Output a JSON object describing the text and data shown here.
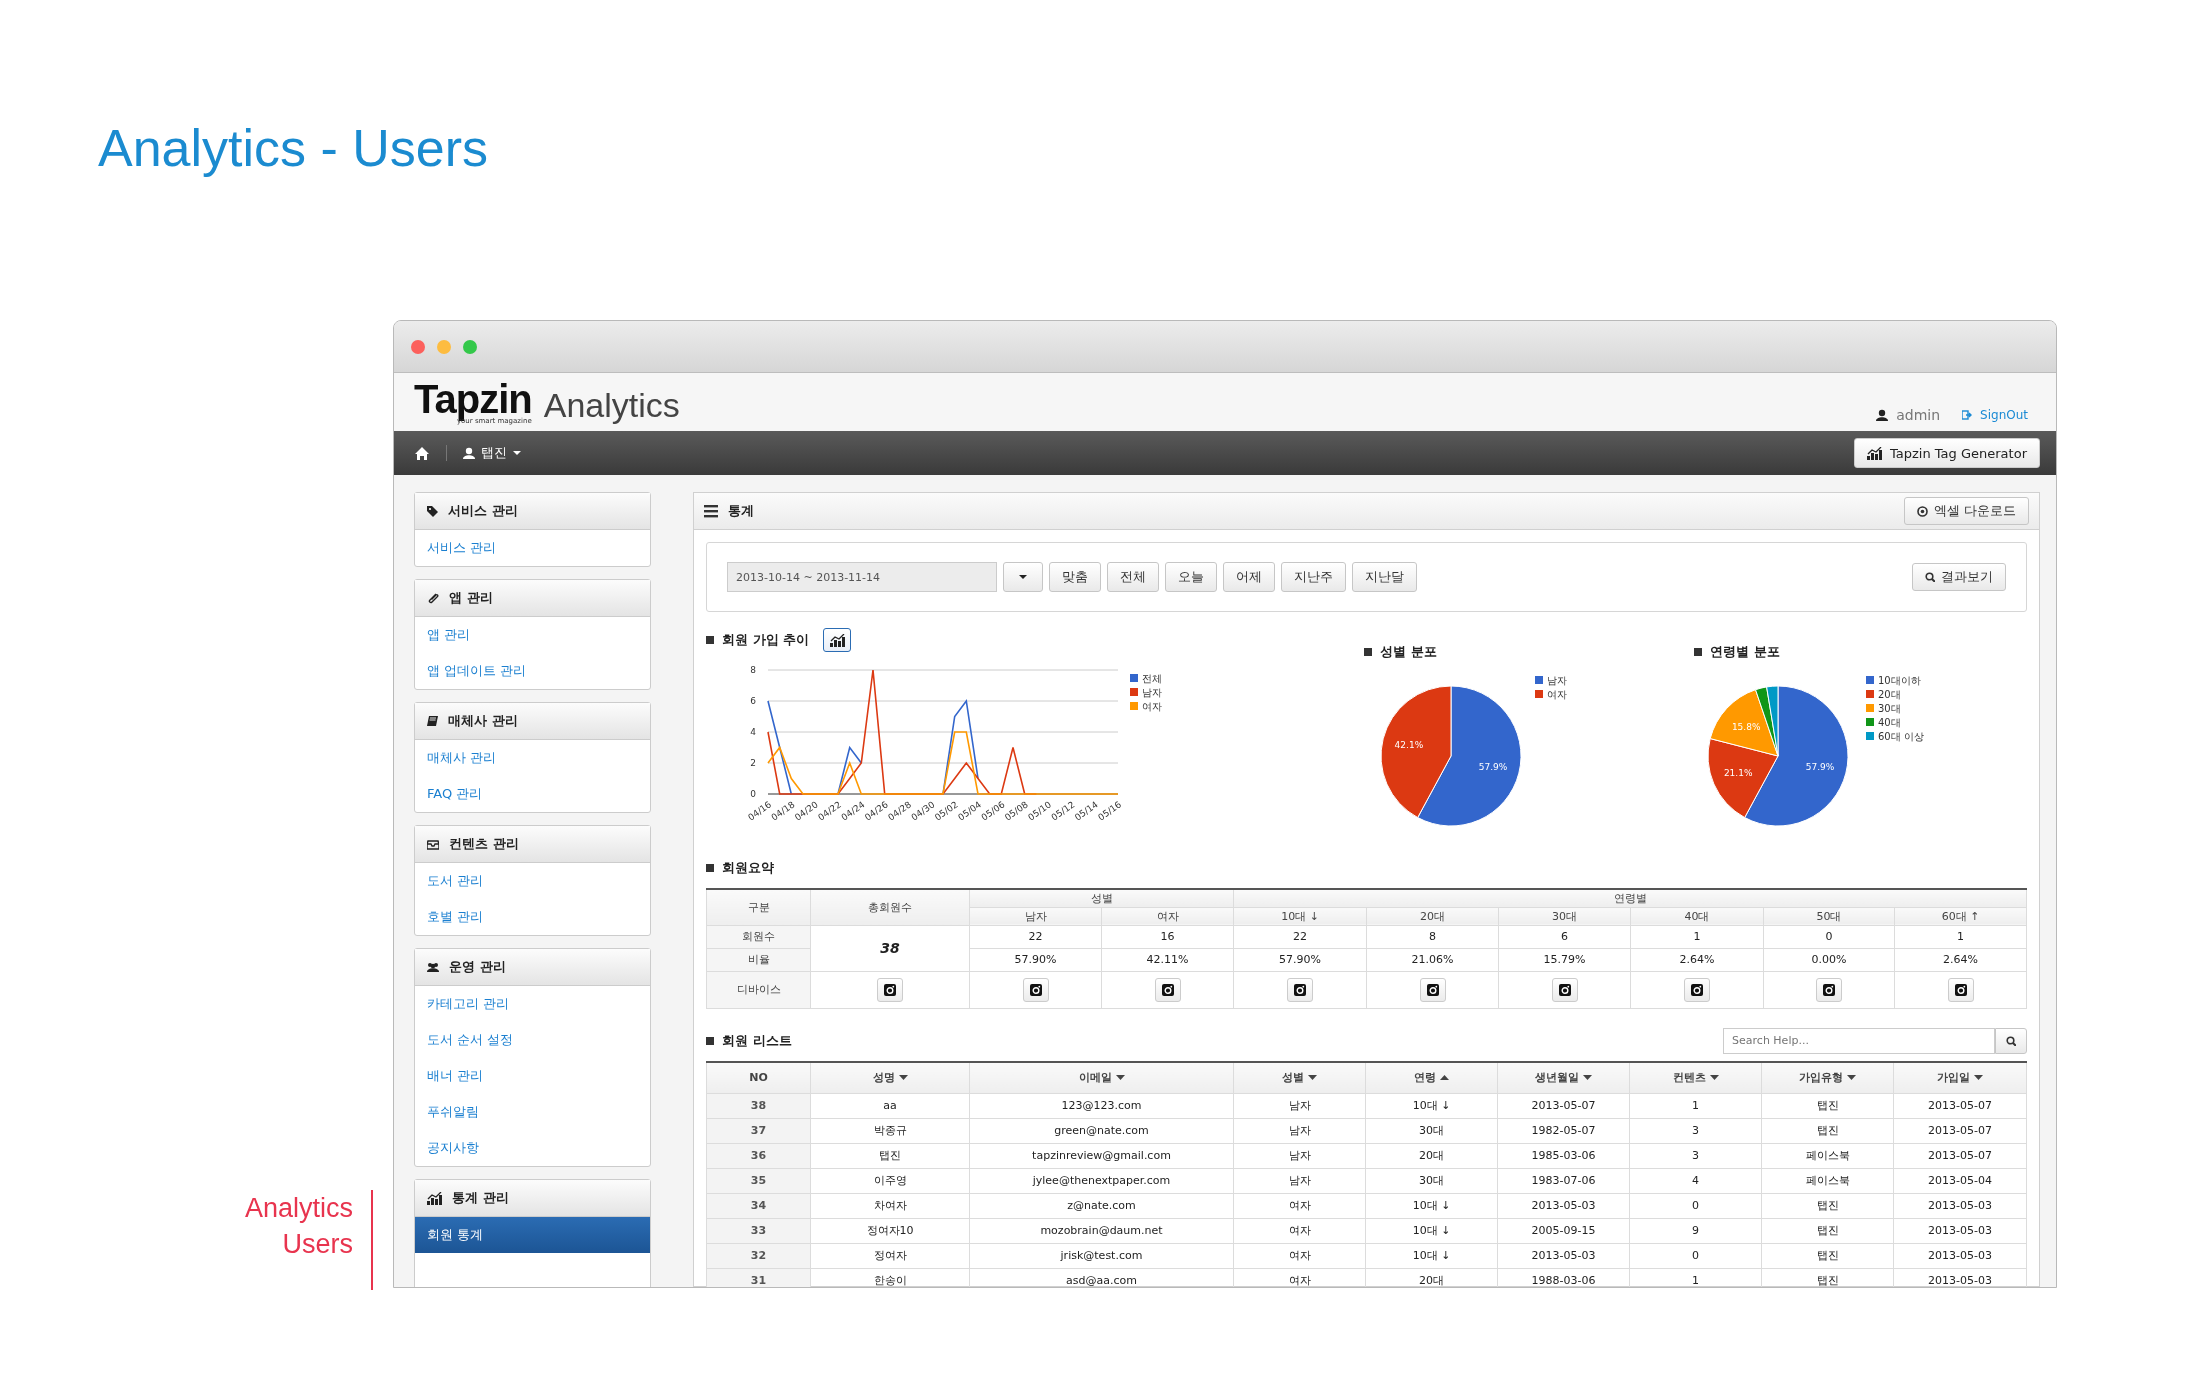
{
  "page_title": "Analytics - Users",
  "caption": [
    "Analytics",
    "Users"
  ],
  "window": {
    "logo": {
      "brand": "Tapzin",
      "tagline": "your smart magazine",
      "product": "Analytics"
    },
    "user": {
      "name": "admin",
      "signout": "SignOut"
    },
    "navbar": {
      "menu": "탭진",
      "button": "Tapzin Tag Generator"
    },
    "sidebar": [
      {
        "title": "서비스 관리",
        "items": [
          {
            "label": "서비스 관리",
            "selected": false
          }
        ]
      },
      {
        "title": "앱 관리",
        "items": [
          {
            "label": "앱 관리",
            "selected": false
          },
          {
            "label": "앱 업데이트 관리",
            "selected": false
          }
        ]
      },
      {
        "title": "매체사 관리",
        "items": [
          {
            "label": "매체사 관리",
            "selected": false
          },
          {
            "label": "FAQ 관리",
            "selected": false
          }
        ]
      },
      {
        "title": "컨텐츠 관리",
        "items": [
          {
            "label": "도서 관리",
            "selected": false
          },
          {
            "label": "호별 관리",
            "selected": false
          }
        ]
      },
      {
        "title": "운영 관리",
        "items": [
          {
            "label": "카테고리 관리",
            "selected": false
          },
          {
            "label": "도서 순서 설정",
            "selected": false
          },
          {
            "label": "배너 관리",
            "selected": false
          },
          {
            "label": "푸쉬알림",
            "selected": false
          },
          {
            "label": "공지사항",
            "selected": false
          }
        ]
      },
      {
        "title": "통계 관리",
        "items": [
          {
            "label": "회원 통계",
            "selected": true
          }
        ]
      }
    ],
    "panel": {
      "title": "통계",
      "download": "엑셀 다운로드"
    },
    "filter": {
      "date_range": "2013-10-14 ~ 2013-11-14",
      "presets": [
        "맞춤",
        "전체",
        "오늘",
        "어제",
        "지난주",
        "지난달"
      ],
      "submit": "결과보기"
    },
    "signup_trend": {
      "title": "회원 가입 추이",
      "chart_data": {
        "type": "line",
        "categories": [
          "04/16",
          null,
          "04/18",
          null,
          "04/20",
          null,
          "04/22",
          null,
          "04/24",
          null,
          "04/26",
          null,
          "04/28",
          null,
          "04/30",
          null,
          "05/02",
          null,
          "05/04",
          null,
          "05/06",
          null,
          "05/08",
          null,
          "05/10",
          null,
          "05/12",
          null,
          "05/14",
          null,
          "05/16"
        ],
        "ylim": [
          0,
          8
        ],
        "yticks": [
          0,
          2,
          4,
          6,
          8
        ],
        "grid": true,
        "legend": "right",
        "series": [
          {
            "name": "전체",
            "color": "#3366cc",
            "values": [
              6,
              3,
              0,
              null,
              null,
              null,
              0,
              3,
              2,
              null,
              null,
              null,
              null,
              null,
              null,
              0,
              5,
              6,
              1,
              null,
              null,
              null,
              null,
              null,
              null,
              null,
              null,
              null,
              null,
              null,
              null
            ]
          },
          {
            "name": "남자",
            "color": "#dc3912",
            "values": [
              4,
              0,
              0,
              0,
              0,
              0,
              0,
              1,
              2,
              8,
              0,
              0,
              0,
              0,
              0,
              0,
              1,
              2,
              1,
              0,
              0,
              3,
              0,
              0,
              null,
              null,
              null,
              null,
              null,
              null,
              null
            ]
          },
          {
            "name": "여자",
            "color": "#ff9900",
            "values": [
              2,
              3,
              1,
              0,
              0,
              0,
              0,
              2,
              0,
              0,
              0,
              0,
              0,
              0,
              0,
              0,
              4,
              4,
              0,
              0,
              0,
              0,
              0,
              0,
              0,
              0,
              0,
              0,
              0,
              0,
              0
            ]
          }
        ]
      }
    },
    "gender": {
      "title": "성별 분포",
      "chart_data": {
        "type": "pie",
        "legend": "right",
        "categories": [
          "남자",
          "여자"
        ],
        "colors": [
          "#3366cc",
          "#dc3912"
        ],
        "values": [
          57.9,
          42.1
        ],
        "value_labels": [
          "57.9%",
          "42.1%"
        ]
      }
    },
    "age": {
      "title": "연령별 분포",
      "chart_data": {
        "type": "pie",
        "legend": "right",
        "categories": [
          "10대이하",
          "20대",
          "30대",
          "40대",
          "60대 이상"
        ],
        "colors": [
          "#3366cc",
          "#dc3912",
          "#ff9900",
          "#109618",
          "#0099c6"
        ],
        "values": [
          57.9,
          21.1,
          15.8,
          2.6,
          2.6
        ],
        "value_labels": [
          "57.9%",
          "21.1%",
          "15.8%",
          null,
          null
        ]
      }
    },
    "summary": {
      "title": "회원요약",
      "corner": "구분",
      "total_header": "총회원수",
      "groups": [
        {
          "label": "성별",
          "columns": [
            "남자",
            "여자"
          ]
        },
        {
          "label": "연령별",
          "columns": [
            "10대 ↓",
            "20대",
            "30대",
            "40대",
            "50대",
            "60대 ↑"
          ]
        }
      ],
      "total": "38",
      "rows": [
        {
          "label": "회원수",
          "kind": "values",
          "values": [
            "22",
            "16",
            "22",
            "8",
            "6",
            "1",
            "0",
            "1"
          ]
        },
        {
          "label": "비율",
          "kind": "values",
          "values": [
            "57.90%",
            "42.11%",
            "57.90%",
            "21.06%",
            "15.79%",
            "2.64%",
            "0.00%",
            "2.64%"
          ]
        },
        {
          "label": "디바이스",
          "kind": "devices"
        }
      ]
    },
    "member_list": {
      "title": "회원 리스트",
      "search": {
        "placeholder": "Search Help..."
      },
      "columns": [
        {
          "label": "NO",
          "sortable": false
        },
        {
          "label": "성명",
          "sortable": true,
          "ascending": false
        },
        {
          "label": "이메일",
          "sortable": true,
          "ascending": false
        },
        {
          "label": "성별",
          "sortable": true,
          "ascending": false
        },
        {
          "label": "연령",
          "sortable": true,
          "ascending": true
        },
        {
          "label": "생년월일",
          "sortable": true,
          "ascending": false
        },
        {
          "label": "컨텐츠",
          "sortable": true,
          "ascending": false
        },
        {
          "label": "가입유형",
          "sortable": true,
          "ascending": false
        },
        {
          "label": "가입일",
          "sortable": true,
          "ascending": false
        }
      ],
      "rows": [
        [
          "38",
          "aa",
          "123@123.com",
          "남자",
          "10대 ↓",
          "2013-05-07",
          "1",
          "탭진",
          "2013-05-07"
        ],
        [
          "37",
          "박종규",
          "green@nate.com",
          "남자",
          "30대",
          "1982-05-07",
          "3",
          "탭진",
          "2013-05-07"
        ],
        [
          "36",
          "탭진",
          "tapzinreview@gmail.com",
          "남자",
          "20대",
          "1985-03-06",
          "3",
          "페이스북",
          "2013-05-07"
        ],
        [
          "35",
          "이주영",
          "jylee@thenextpaper.com",
          "남자",
          "30대",
          "1983-07-06",
          "4",
          "페이스북",
          "2013-05-04"
        ],
        [
          "34",
          "차여자",
          "z@nate.com",
          "여자",
          "10대 ↓",
          "2013-05-03",
          "0",
          "탭진",
          "2013-05-03"
        ],
        [
          "33",
          "정여자10",
          "mozobrain@daum.net",
          "여자",
          "10대 ↓",
          "2005-09-15",
          "9",
          "탭진",
          "2013-05-03"
        ],
        [
          "32",
          "정여자",
          "jrisk@test.com",
          "여자",
          "10대 ↓",
          "2013-05-03",
          "0",
          "탭진",
          "2013-05-03"
        ],
        [
          "31",
          "한송이",
          "asd@aa.com",
          "여자",
          "20대",
          "1988-03-06",
          "1",
          "탭진",
          "2013-05-03"
        ]
      ]
    }
  }
}
